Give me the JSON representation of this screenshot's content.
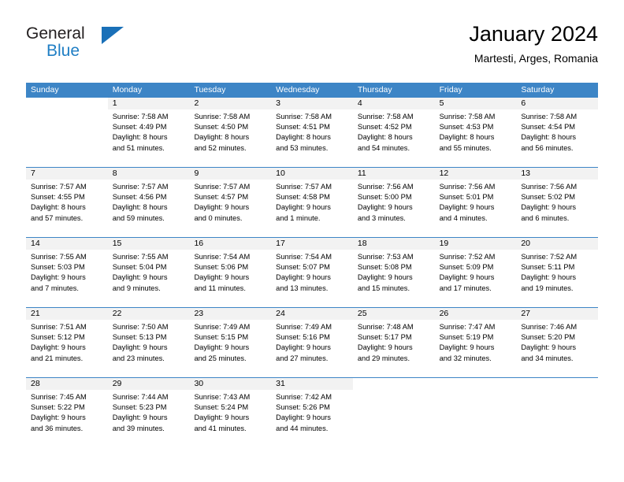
{
  "brand": {
    "name_part1": "General",
    "name_part2": "Blue",
    "logo_icon": "triangle-logo"
  },
  "header": {
    "title": "January 2024",
    "subtitle": "Martesti, Arges, Romania"
  },
  "colors": {
    "header_blue": "#3d85c6",
    "day_number_bg": "#f2f2f2",
    "brand_blue": "#1f7ec4",
    "text": "#000000"
  },
  "weekdays": [
    "Sunday",
    "Monday",
    "Tuesday",
    "Wednesday",
    "Thursday",
    "Friday",
    "Saturday"
  ],
  "weeks": [
    [
      {
        "day": "",
        "empty": true,
        "sunrise": "",
        "sunset": "",
        "daylight1": "",
        "daylight2": ""
      },
      {
        "day": "1",
        "sunrise": "Sunrise: 7:58 AM",
        "sunset": "Sunset: 4:49 PM",
        "daylight1": "Daylight: 8 hours",
        "daylight2": "and 51 minutes."
      },
      {
        "day": "2",
        "sunrise": "Sunrise: 7:58 AM",
        "sunset": "Sunset: 4:50 PM",
        "daylight1": "Daylight: 8 hours",
        "daylight2": "and 52 minutes."
      },
      {
        "day": "3",
        "sunrise": "Sunrise: 7:58 AM",
        "sunset": "Sunset: 4:51 PM",
        "daylight1": "Daylight: 8 hours",
        "daylight2": "and 53 minutes."
      },
      {
        "day": "4",
        "sunrise": "Sunrise: 7:58 AM",
        "sunset": "Sunset: 4:52 PM",
        "daylight1": "Daylight: 8 hours",
        "daylight2": "and 54 minutes."
      },
      {
        "day": "5",
        "sunrise": "Sunrise: 7:58 AM",
        "sunset": "Sunset: 4:53 PM",
        "daylight1": "Daylight: 8 hours",
        "daylight2": "and 55 minutes."
      },
      {
        "day": "6",
        "sunrise": "Sunrise: 7:58 AM",
        "sunset": "Sunset: 4:54 PM",
        "daylight1": "Daylight: 8 hours",
        "daylight2": "and 56 minutes."
      }
    ],
    [
      {
        "day": "7",
        "sunrise": "Sunrise: 7:57 AM",
        "sunset": "Sunset: 4:55 PM",
        "daylight1": "Daylight: 8 hours",
        "daylight2": "and 57 minutes."
      },
      {
        "day": "8",
        "sunrise": "Sunrise: 7:57 AM",
        "sunset": "Sunset: 4:56 PM",
        "daylight1": "Daylight: 8 hours",
        "daylight2": "and 59 minutes."
      },
      {
        "day": "9",
        "sunrise": "Sunrise: 7:57 AM",
        "sunset": "Sunset: 4:57 PM",
        "daylight1": "Daylight: 9 hours",
        "daylight2": "and 0 minutes."
      },
      {
        "day": "10",
        "sunrise": "Sunrise: 7:57 AM",
        "sunset": "Sunset: 4:58 PM",
        "daylight1": "Daylight: 9 hours",
        "daylight2": "and 1 minute."
      },
      {
        "day": "11",
        "sunrise": "Sunrise: 7:56 AM",
        "sunset": "Sunset: 5:00 PM",
        "daylight1": "Daylight: 9 hours",
        "daylight2": "and 3 minutes."
      },
      {
        "day": "12",
        "sunrise": "Sunrise: 7:56 AM",
        "sunset": "Sunset: 5:01 PM",
        "daylight1": "Daylight: 9 hours",
        "daylight2": "and 4 minutes."
      },
      {
        "day": "13",
        "sunrise": "Sunrise: 7:56 AM",
        "sunset": "Sunset: 5:02 PM",
        "daylight1": "Daylight: 9 hours",
        "daylight2": "and 6 minutes."
      }
    ],
    [
      {
        "day": "14",
        "sunrise": "Sunrise: 7:55 AM",
        "sunset": "Sunset: 5:03 PM",
        "daylight1": "Daylight: 9 hours",
        "daylight2": "and 7 minutes."
      },
      {
        "day": "15",
        "sunrise": "Sunrise: 7:55 AM",
        "sunset": "Sunset: 5:04 PM",
        "daylight1": "Daylight: 9 hours",
        "daylight2": "and 9 minutes."
      },
      {
        "day": "16",
        "sunrise": "Sunrise: 7:54 AM",
        "sunset": "Sunset: 5:06 PM",
        "daylight1": "Daylight: 9 hours",
        "daylight2": "and 11 minutes."
      },
      {
        "day": "17",
        "sunrise": "Sunrise: 7:54 AM",
        "sunset": "Sunset: 5:07 PM",
        "daylight1": "Daylight: 9 hours",
        "daylight2": "and 13 minutes."
      },
      {
        "day": "18",
        "sunrise": "Sunrise: 7:53 AM",
        "sunset": "Sunset: 5:08 PM",
        "daylight1": "Daylight: 9 hours",
        "daylight2": "and 15 minutes."
      },
      {
        "day": "19",
        "sunrise": "Sunrise: 7:52 AM",
        "sunset": "Sunset: 5:09 PM",
        "daylight1": "Daylight: 9 hours",
        "daylight2": "and 17 minutes."
      },
      {
        "day": "20",
        "sunrise": "Sunrise: 7:52 AM",
        "sunset": "Sunset: 5:11 PM",
        "daylight1": "Daylight: 9 hours",
        "daylight2": "and 19 minutes."
      }
    ],
    [
      {
        "day": "21",
        "sunrise": "Sunrise: 7:51 AM",
        "sunset": "Sunset: 5:12 PM",
        "daylight1": "Daylight: 9 hours",
        "daylight2": "and 21 minutes."
      },
      {
        "day": "22",
        "sunrise": "Sunrise: 7:50 AM",
        "sunset": "Sunset: 5:13 PM",
        "daylight1": "Daylight: 9 hours",
        "daylight2": "and 23 minutes."
      },
      {
        "day": "23",
        "sunrise": "Sunrise: 7:49 AM",
        "sunset": "Sunset: 5:15 PM",
        "daylight1": "Daylight: 9 hours",
        "daylight2": "and 25 minutes."
      },
      {
        "day": "24",
        "sunrise": "Sunrise: 7:49 AM",
        "sunset": "Sunset: 5:16 PM",
        "daylight1": "Daylight: 9 hours",
        "daylight2": "and 27 minutes."
      },
      {
        "day": "25",
        "sunrise": "Sunrise: 7:48 AM",
        "sunset": "Sunset: 5:17 PM",
        "daylight1": "Daylight: 9 hours",
        "daylight2": "and 29 minutes."
      },
      {
        "day": "26",
        "sunrise": "Sunrise: 7:47 AM",
        "sunset": "Sunset: 5:19 PM",
        "daylight1": "Daylight: 9 hours",
        "daylight2": "and 32 minutes."
      },
      {
        "day": "27",
        "sunrise": "Sunrise: 7:46 AM",
        "sunset": "Sunset: 5:20 PM",
        "daylight1": "Daylight: 9 hours",
        "daylight2": "and 34 minutes."
      }
    ],
    [
      {
        "day": "28",
        "sunrise": "Sunrise: 7:45 AM",
        "sunset": "Sunset: 5:22 PM",
        "daylight1": "Daylight: 9 hours",
        "daylight2": "and 36 minutes."
      },
      {
        "day": "29",
        "sunrise": "Sunrise: 7:44 AM",
        "sunset": "Sunset: 5:23 PM",
        "daylight1": "Daylight: 9 hours",
        "daylight2": "and 39 minutes."
      },
      {
        "day": "30",
        "sunrise": "Sunrise: 7:43 AM",
        "sunset": "Sunset: 5:24 PM",
        "daylight1": "Daylight: 9 hours",
        "daylight2": "and 41 minutes."
      },
      {
        "day": "31",
        "sunrise": "Sunrise: 7:42 AM",
        "sunset": "Sunset: 5:26 PM",
        "daylight1": "Daylight: 9 hours",
        "daylight2": "and 44 minutes."
      },
      {
        "day": "",
        "empty": true,
        "sunrise": "",
        "sunset": "",
        "daylight1": "",
        "daylight2": ""
      },
      {
        "day": "",
        "empty": true,
        "sunrise": "",
        "sunset": "",
        "daylight1": "",
        "daylight2": ""
      },
      {
        "day": "",
        "empty": true,
        "sunrise": "",
        "sunset": "",
        "daylight1": "",
        "daylight2": ""
      }
    ]
  ]
}
